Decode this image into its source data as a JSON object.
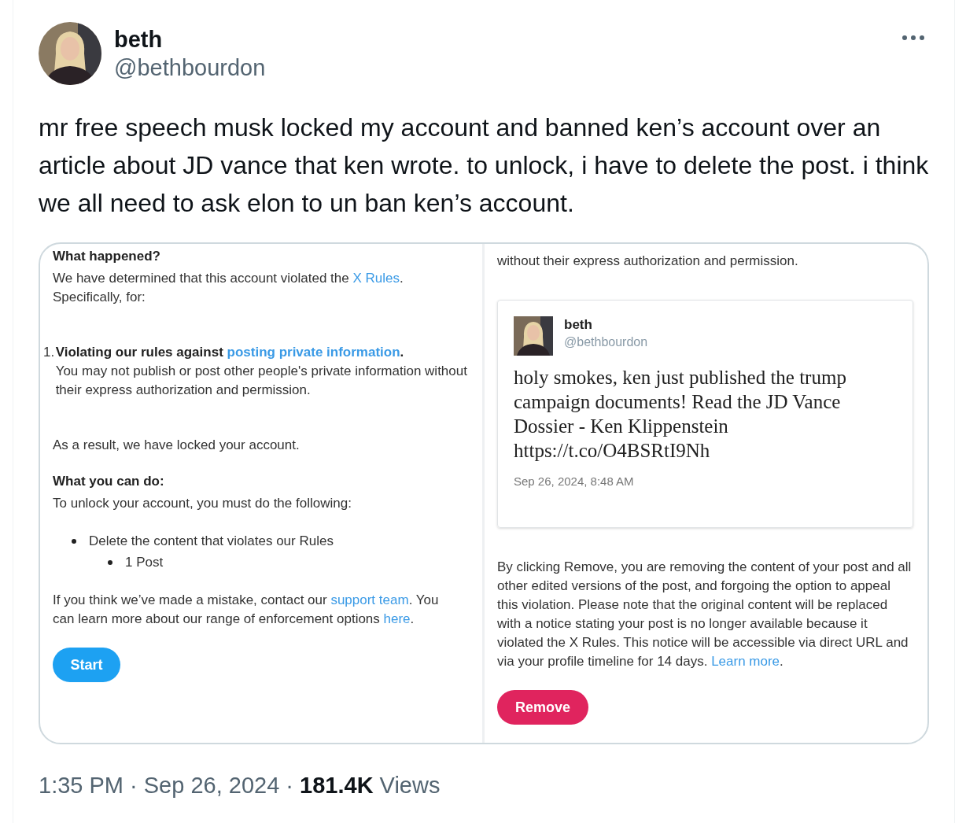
{
  "post": {
    "author": {
      "name": "beth",
      "handle": "@bethbourdon"
    },
    "text": "mr free speech musk locked my account and banned ken’s account over an article about JD vance that ken wrote. to unlock, i have to delete the post. i think we all need to ask elon to un ban ken’s account.",
    "attached_image": {
      "left_panel": {
        "heading_1": "What happened?",
        "intro": [
          {
            "kind": "text",
            "text": "We have determined that this account violated the "
          },
          {
            "kind": "link",
            "text": "X Rules"
          },
          {
            "kind": "text",
            "text": ". Specifically, for:"
          }
        ],
        "violation": {
          "number": "1.",
          "title": [
            {
              "kind": "text",
              "text": "Violating our rules against "
            },
            {
              "kind": "link",
              "text": "posting private information"
            },
            {
              "kind": "text",
              "text": "."
            }
          ],
          "description": "You may not publish or post other people's private information without their express authorization and permission."
        },
        "result": "As a result, we have locked your account.",
        "heading_2": "What you can do:",
        "instructions": "To unlock your account, you must do the following:",
        "steps": [
          {
            "text": "Delete the content that violates our Rules",
            "children": [
              {
                "text": "1 Post"
              }
            ]
          }
        ],
        "help": [
          {
            "kind": "text",
            "text": "If you think we’ve made a mistake, contact our "
          },
          {
            "kind": "link",
            "text": "support team"
          },
          {
            "kind": "text",
            "text": ". You can learn more about our range of enforcement options "
          },
          {
            "kind": "link",
            "text": "here"
          },
          {
            "kind": "text",
            "text": "."
          }
        ],
        "button": "Start"
      },
      "right_panel": {
        "top_text": "without their express authorization and permission.",
        "quoted_post": {
          "name": "beth",
          "handle": "@bethbourdon",
          "text": "holy smokes, ken just published the trump campaign documents! Read the JD Vance Dossier - Ken Klippenstein https://t.co/O4BSRtI9Nh",
          "time": "Sep 26, 2024, 8:48 AM"
        },
        "notice": [
          {
            "kind": "text",
            "text": "By clicking Remove, you are removing the content of your post and all other edited versions of the post, and forgoing the option to appeal this violation. Please note that the original content will be replaced with a notice stating your post is no longer available because it violated the X Rules. This notice will be accessible via direct URL and via your profile timeline for 14 days. "
          },
          {
            "kind": "link",
            "text": "Learn more"
          },
          {
            "kind": "text",
            "text": "."
          }
        ],
        "button": "Remove"
      }
    },
    "timestamp": "1:35 PM · Sep 26, 2024 · ",
    "views_count": "181.4K",
    "views_label": "Views"
  }
}
